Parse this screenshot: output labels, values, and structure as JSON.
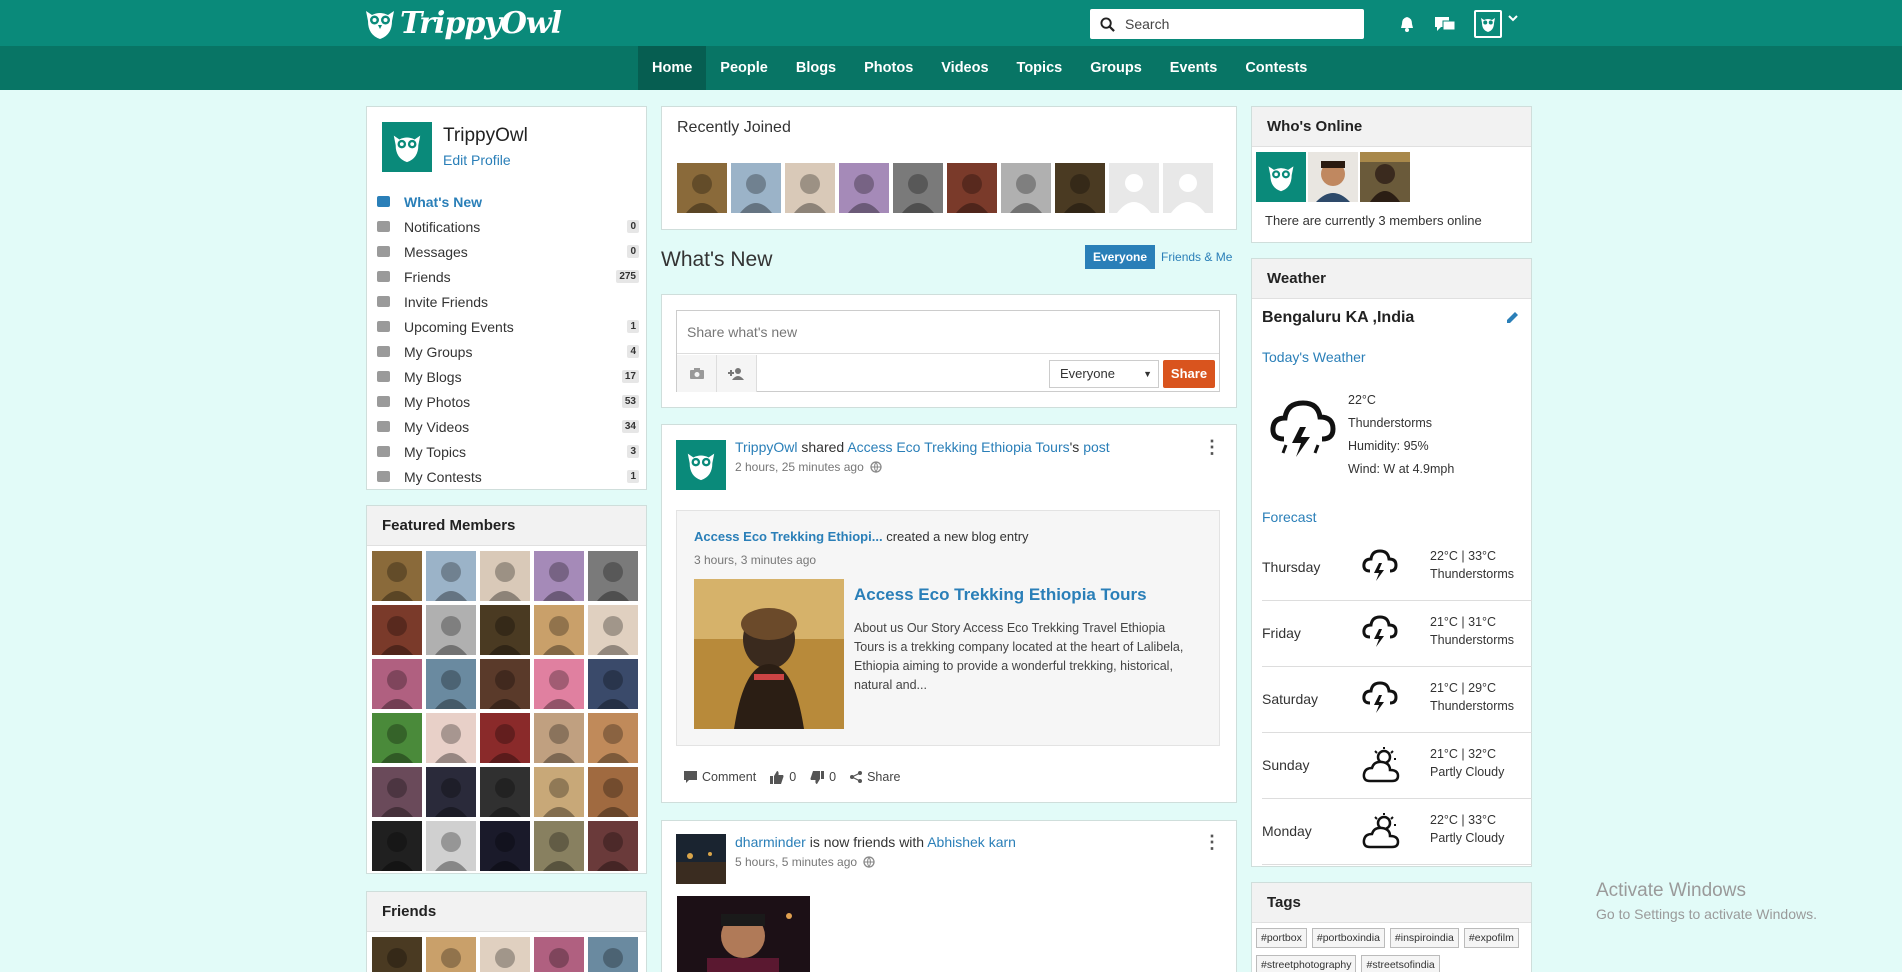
{
  "brand": {
    "name": "TrippyOwl"
  },
  "header": {
    "search_placeholder": "Search"
  },
  "nav": [
    "Home",
    "People",
    "Blogs",
    "Photos",
    "Videos",
    "Topics",
    "Groups",
    "Events",
    "Contests"
  ],
  "profile": {
    "name": "TrippyOwl",
    "edit_label": "Edit Profile",
    "menu": [
      {
        "label": "What's New",
        "badge": "",
        "icon": "news-icon"
      },
      {
        "label": "Notifications",
        "badge": "0",
        "icon": "bell-icon"
      },
      {
        "label": "Messages",
        "badge": "0",
        "icon": "mail-icon"
      },
      {
        "label": "Friends",
        "badge": "275",
        "icon": "friends-icon"
      },
      {
        "label": "Invite Friends",
        "badge": "",
        "icon": "share-icon"
      },
      {
        "label": "Upcoming Events",
        "badge": "1",
        "icon": "calendar-icon"
      },
      {
        "label": "My Groups",
        "badge": "4",
        "icon": "groups-icon"
      },
      {
        "label": "My Blogs",
        "badge": "17",
        "icon": "blog-icon"
      },
      {
        "label": "My Photos",
        "badge": "53",
        "icon": "photo-icon"
      },
      {
        "label": "My Videos",
        "badge": "34",
        "icon": "video-icon"
      },
      {
        "label": "My Topics",
        "badge": "3",
        "icon": "topic-icon"
      },
      {
        "label": "My Contests",
        "badge": "1",
        "icon": "trophy-icon"
      }
    ]
  },
  "featured": {
    "title": "Featured Members"
  },
  "friends": {
    "title": "Friends"
  },
  "recently_joined": {
    "title": "Recently Joined"
  },
  "whats_new": {
    "title": "What's New",
    "filter_active": "Everyone",
    "filter_other": "Friends & Me",
    "composer_placeholder": "Share what's new",
    "privacy": "Everyone",
    "share_label": "Share"
  },
  "feed": [
    {
      "actor": "TrippyOwl",
      "verb": " shared ",
      "target": "Access Eco Trekking Ethiopia Tours",
      "possessive": "'s ",
      "object": "post",
      "time": "2 hours, 25 minutes ago",
      "shared": {
        "author": "Access Eco Trekking Ethiopi...",
        "action": " created a new blog entry",
        "time": "3 hours, 3 minutes ago",
        "title": "Access Eco Trekking Ethiopia Tours",
        "excerpt": "About us Our Story Access Eco Trekking Travel Ethiopia Tours is a trekking company located at the heart of Lalibela, Ethiopia aiming to provide a wonderful trekking, historical, natural and..."
      },
      "actions": {
        "comment": "Comment",
        "likes": "0",
        "dislikes": "0",
        "share": "Share"
      }
    },
    {
      "actor": "dharminder",
      "verb": " is now friends with ",
      "target": "Abhishek karn",
      "time": "5 hours, 5 minutes ago"
    }
  ],
  "whos_online": {
    "title": "Who's Online",
    "text": "There are currently 3 members online"
  },
  "weather": {
    "title": "Weather",
    "city": "Bengaluru KA ,India",
    "today_label": "Today's Weather",
    "current": {
      "temp": "22°C",
      "condition": "Thunderstorms",
      "humidity": "Humidity: 95%",
      "wind": "Wind: W at 4.9mph"
    },
    "forecast_label": "Forecast",
    "forecast": [
      {
        "day": "Thursday",
        "temps": "22°C | 33°C",
        "condition": "Thunderstorms",
        "icon": "thunderstorm-icon"
      },
      {
        "day": "Friday",
        "temps": "21°C | 31°C",
        "condition": "Thunderstorms",
        "icon": "thunderstorm-icon"
      },
      {
        "day": "Saturday",
        "temps": "21°C | 29°C",
        "condition": "Thunderstorms",
        "icon": "thunderstorm-icon"
      },
      {
        "day": "Sunday",
        "temps": "21°C | 32°C",
        "condition": "Partly Cloudy",
        "icon": "partly-cloudy-icon"
      },
      {
        "day": "Monday",
        "temps": "22°C | 33°C",
        "condition": "Partly Cloudy",
        "icon": "partly-cloudy-icon"
      }
    ]
  },
  "tags": {
    "title": "Tags",
    "items": [
      "#portbox",
      "#portboxindia",
      "#inspiroindia",
      "#expofilm",
      "#streetphotography",
      "#streetsofindia"
    ]
  },
  "windows": {
    "line1": "Activate Windows",
    "line2": "Go to Settings to activate Windows."
  },
  "colors": {
    "primary": "#0a8a7a",
    "nav": "#087565",
    "accent": "#2a7fb8",
    "share": "#d9541e",
    "background": "#e2fbf8"
  }
}
